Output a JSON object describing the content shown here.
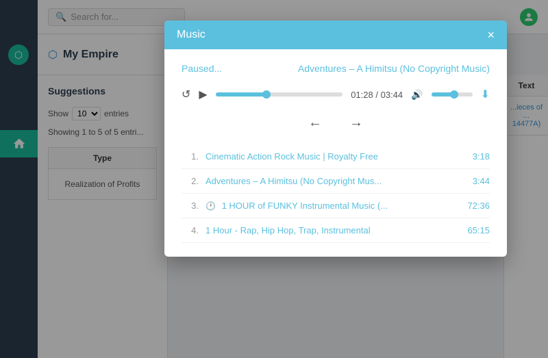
{
  "app": {
    "title": "My Empire"
  },
  "topbar": {
    "search_placeholder": "Search for..."
  },
  "sidebar": {
    "active_section": "dashboard"
  },
  "suggestions": {
    "label": "Suggestions",
    "show_label": "Show",
    "entries_value": "10",
    "entries_label": "entries",
    "showing_text": "Showing 1 to 5 of 5 entri...",
    "type_column": "Type",
    "text_column": "Text",
    "row1_type": "Realization of Profits",
    "row1_text": "...ieces of ...\n14477A)"
  },
  "music_modal": {
    "title": "Music",
    "close": "×",
    "paused_label": "Paused...",
    "track_name": "Adventures – A Himitsu",
    "track_suffix": "(No Copyright Music)",
    "current_time": "01:28",
    "separator": "/",
    "total_time": "03:44",
    "tracks": [
      {
        "number": "1.",
        "title": "Cinematic Action Rock Music | Royalty Free",
        "duration": "3:18"
      },
      {
        "number": "2.",
        "title": "Adventures – A Himitsu (No Copyright Mus...",
        "duration": "3:44"
      },
      {
        "number": "3.",
        "title": "1 HOUR of FUNKY Instrumental Music (...",
        "duration": "72:36",
        "has_icon": true
      },
      {
        "number": "4.",
        "title": "1 Hour - Rap, Hip Hop, Trap, Instrumental",
        "duration": "65:15"
      }
    ]
  }
}
